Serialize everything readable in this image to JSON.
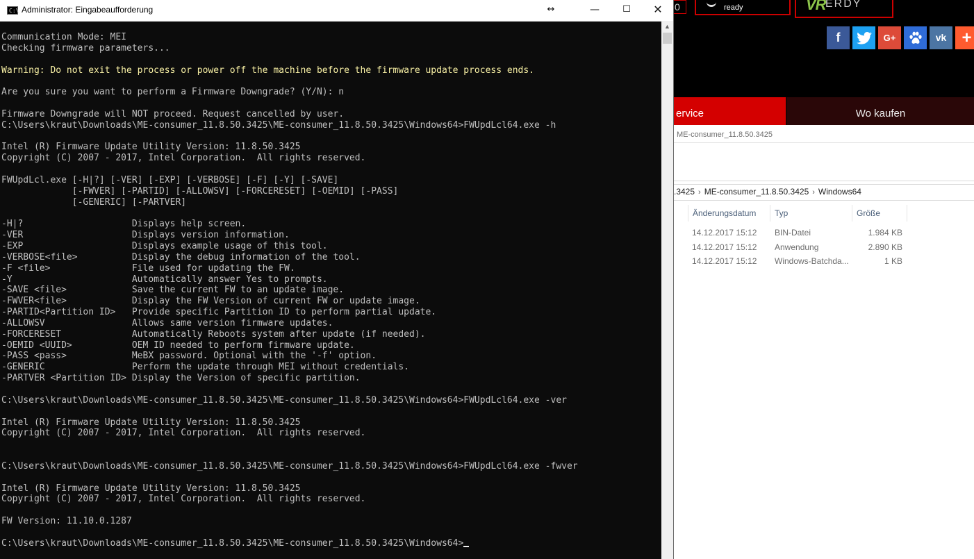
{
  "cmd": {
    "title": "Administrator: Eingabeaufforderung",
    "icon_text": "C:\\",
    "controls": {
      "resize_icon": "↔",
      "minimize_icon": "—",
      "maximize_icon": "☐",
      "close_icon": "✕"
    },
    "lines": [
      {
        "text": "Communication Mode: MEI"
      },
      {
        "text": "Checking firmware parameters..."
      },
      {
        "text": ""
      },
      {
        "text": "Warning: Do not exit the process or power off the machine before the firmware update process ends.",
        "style": "warn"
      },
      {
        "text": ""
      },
      {
        "text": "Are you sure you want to perform a Firmware Downgrade? (Y/N): n"
      },
      {
        "text": ""
      },
      {
        "text": "Firmware Downgrade will NOT proceed. Request cancelled by user."
      },
      {
        "text": "C:\\Users\\kraut\\Downloads\\ME-consumer_11.8.50.3425\\ME-consumer_11.8.50.3425\\Windows64>FWUpdLcl64.exe -h"
      },
      {
        "text": ""
      },
      {
        "text": "Intel (R) Firmware Update Utility Version: 11.8.50.3425"
      },
      {
        "text": "Copyright (C) 2007 - 2017, Intel Corporation.  All rights reserved."
      },
      {
        "text": ""
      },
      {
        "text": "FWUpdLcl.exe [-H|?] [-VER] [-EXP] [-VERBOSE] [-F] [-Y] [-SAVE]"
      },
      {
        "text": "             [-FWVER] [-PARTID] [-ALLOWSV] [-FORCERESET] [-OEMID] [-PASS]"
      },
      {
        "text": "             [-GENERIC] [-PARTVER]"
      },
      {
        "text": ""
      },
      {
        "text": "-H|?                    Displays help screen."
      },
      {
        "text": "-VER                    Displays version information."
      },
      {
        "text": "-EXP                    Displays example usage of this tool."
      },
      {
        "text": "-VERBOSE<file>          Display the debug information of the tool."
      },
      {
        "text": "-F <file>               File used for updating the FW."
      },
      {
        "text": "-Y                      Automatically answer Yes to prompts."
      },
      {
        "text": "-SAVE <file>            Save the current FW to an update image."
      },
      {
        "text": "-FWVER<file>            Display the FW Version of current FW or update image."
      },
      {
        "text": "-PARTID<Partition ID>   Provide specific Partition ID to perform partial update."
      },
      {
        "text": "-ALLOWSV                Allows same version firmware updates."
      },
      {
        "text": "-FORCERESET             Automatically Reboots system after update (if needed)."
      },
      {
        "text": "-OEMID <UUID>           OEM ID needed to perform firmware update."
      },
      {
        "text": "-PASS <pass>            MeBX password. Optional with the '-f' option."
      },
      {
        "text": "-GENERIC                Perform the update through MEI without credentials."
      },
      {
        "text": "-PARTVER <Partition ID> Display the Version of specific partition."
      },
      {
        "text": ""
      },
      {
        "text": "C:\\Users\\kraut\\Downloads\\ME-consumer_11.8.50.3425\\ME-consumer_11.8.50.3425\\Windows64>FWUpdLcl64.exe -ver"
      },
      {
        "text": ""
      },
      {
        "text": "Intel (R) Firmware Update Utility Version: 11.8.50.3425"
      },
      {
        "text": "Copyright (C) 2007 - 2017, Intel Corporation.  All rights reserved."
      },
      {
        "text": ""
      },
      {
        "text": ""
      },
      {
        "text": "C:\\Users\\kraut\\Downloads\\ME-consumer_11.8.50.3425\\ME-consumer_11.8.50.3425\\Windows64>FWUpdLcl64.exe -fwver"
      },
      {
        "text": ""
      },
      {
        "text": "Intel (R) Firmware Update Utility Version: 11.8.50.3425"
      },
      {
        "text": "Copyright (C) 2007 - 2017, Intel Corporation.  All rights reserved."
      },
      {
        "text": ""
      },
      {
        "text": "FW Version: 11.10.0.1287"
      },
      {
        "text": ""
      },
      {
        "text": "C:\\Users\\kraut\\Downloads\\ME-consumer_11.8.50.3425\\ME-consumer_11.8.50.3425\\Windows64>",
        "cursor": true
      }
    ]
  },
  "website": {
    "badge_number": "0",
    "badge_ready_text": "ready",
    "vr_logo": "VR",
    "vr_ready": "ERDY",
    "social": {
      "facebook": "f",
      "google": "G+",
      "vk": "vk",
      "plus": "+"
    },
    "nav": {
      "service": "ervice",
      "wo_kaufen": "Wo kaufen"
    }
  },
  "explorer": {
    "title": "ME-consumer_11.8.50.3425",
    "breadcrumb": [
      ".3425",
      "ME-consumer_11.8.50.3425",
      "Windows64"
    ],
    "breadcrumb_separator": "›",
    "columns": {
      "date": "Änderungsdatum",
      "type": "Typ",
      "size": "Größe"
    },
    "files": [
      {
        "date": "14.12.2017 15:12",
        "type": "BIN-Datei",
        "size": "1.984 KB"
      },
      {
        "date": "14.12.2017 15:12",
        "type": "Anwendung",
        "size": "2.890 KB"
      },
      {
        "date": "14.12.2017 15:12",
        "type": "Windows-Batchda...",
        "size": "1 KB"
      }
    ]
  },
  "colors": {
    "console_bg": "#0c0c0c",
    "console_text": "#c0c0c0",
    "warning_text": "#f9f1a5",
    "nav_red": "#d40000"
  }
}
